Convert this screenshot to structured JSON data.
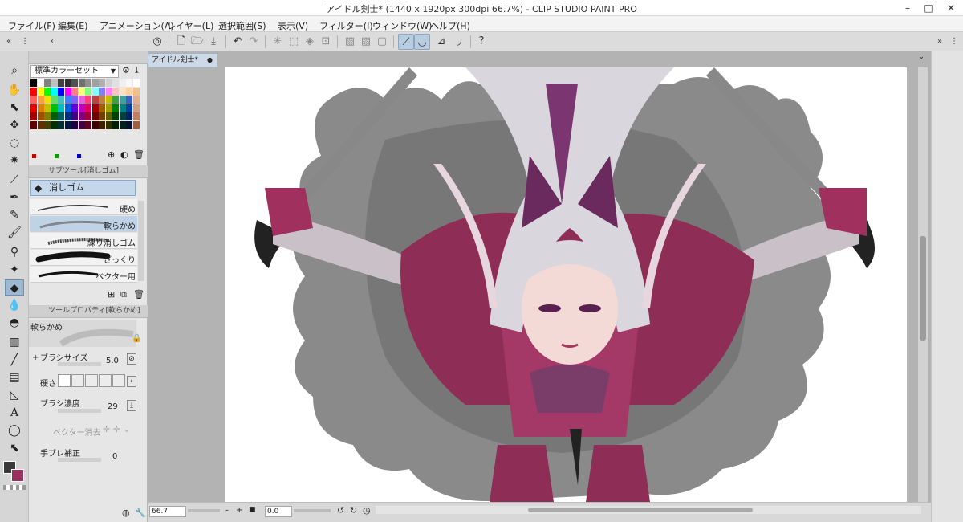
{
  "window": {
    "title": "アイドル剣士* (1440 x 1920px 300dpi 66.7%)  - CLIP STUDIO PAINT PRO",
    "minimize": "–",
    "maximize": "□",
    "close": "✕"
  },
  "menu": [
    "ファイル(F)",
    "編集(E)",
    "アニメーション(A)",
    "レイヤー(L)",
    "選択範囲(S)",
    "表示(V)",
    "フィルター(I)",
    "ウィンドウ(W)",
    "ヘルプ(H)"
  ],
  "color_set": {
    "name": "標準カラーセット"
  },
  "subtool": {
    "header": "サブツール[消しゴム]",
    "group": "消しゴム",
    "brushes": [
      "硬め",
      "軟らかめ",
      "練り消しゴム",
      "ざっくり",
      "ベクター用"
    ]
  },
  "tool_property": {
    "header": "ツールプロパティ[軟らかめ]",
    "preset": "軟らかめ",
    "brush_size_label": "ブラシサイズ",
    "brush_size": "5.0",
    "hardness_label": "硬さ",
    "density_label": "ブラシ濃度",
    "density": "29",
    "vector_erase_label": "ベクター消去",
    "stabilization_label": "手ブレ補正",
    "stabilization": "0"
  },
  "canvas": {
    "tab_label": "アイドル剣士*",
    "zoom": "66.7",
    "rotation": "0.0"
  },
  "colors": {
    "main": "#3a3a3a",
    "sub": "#9a3060",
    "accent": "#9fb8d2"
  }
}
